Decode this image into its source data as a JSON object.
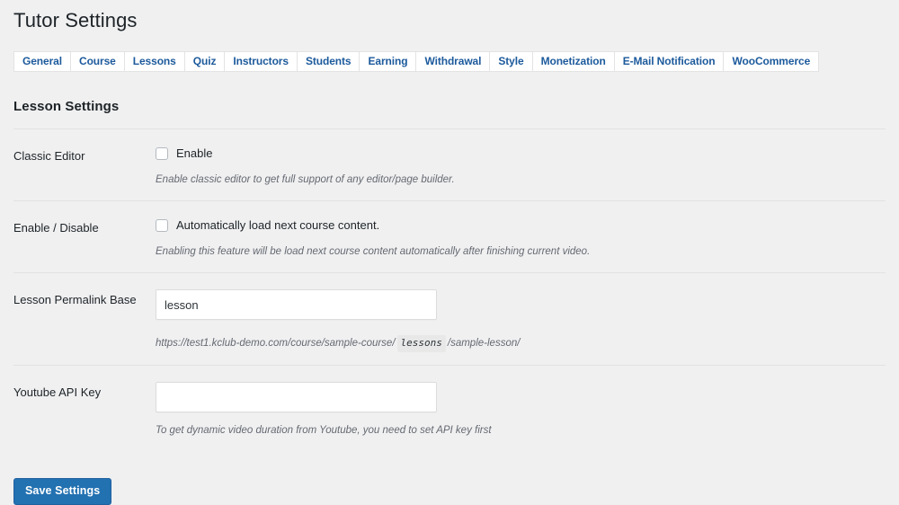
{
  "header": {
    "title": "Tutor Settings"
  },
  "tabs": [
    {
      "label": "General",
      "active": false
    },
    {
      "label": "Course",
      "active": false
    },
    {
      "label": "Lessons",
      "active": false
    },
    {
      "label": "Quiz",
      "active": false
    },
    {
      "label": "Instructors",
      "active": false
    },
    {
      "label": "Students",
      "active": false
    },
    {
      "label": "Earning",
      "active": false
    },
    {
      "label": "Withdrawal",
      "active": false
    },
    {
      "label": "Style",
      "active": false
    },
    {
      "label": "Monetization",
      "active": false
    },
    {
      "label": "E-Mail Notification",
      "active": false
    },
    {
      "label": "WooCommerce",
      "active": false
    }
  ],
  "section": {
    "heading": "Lesson Settings"
  },
  "rows": {
    "classic_editor": {
      "label": "Classic Editor",
      "checkbox_label": "Enable",
      "checked": false,
      "description": "Enable classic editor to get full support of any editor/page builder."
    },
    "enable_disable": {
      "label": "Enable / Disable",
      "checkbox_label": "Automatically load next course content.",
      "checked": false,
      "description": "Enabling this feature will be load next course content automatically after finishing current video."
    },
    "lesson_permalink": {
      "label": "Lesson Permalink Base",
      "value": "lesson",
      "placeholder": "",
      "hint_prefix": "https://test1.kclub-demo.com/course/sample-course/",
      "hint_code": "lessons",
      "hint_suffix": "/sample-lesson/"
    },
    "youtube_api_key": {
      "label": "Youtube API Key",
      "value": "",
      "placeholder": "",
      "description": "To get dynamic video duration from Youtube, you need to set API key first"
    }
  },
  "footer": {
    "save_label": "Save Settings"
  },
  "colors": {
    "accent": "#2271b1",
    "tab_text": "#1c5a9c",
    "page_bg": "#f0f0f1",
    "divider": "#e2e2e3"
  }
}
